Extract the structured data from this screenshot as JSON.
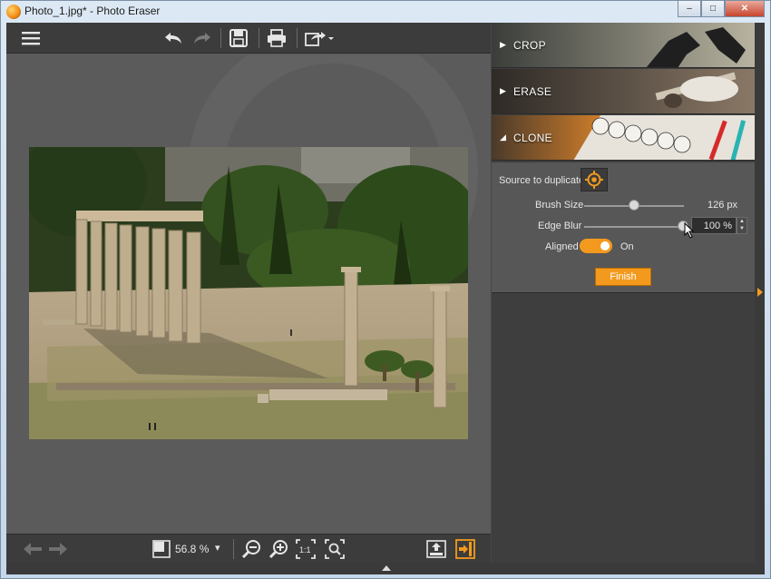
{
  "window": {
    "title": "Photo_1.jpg* - Photo Eraser",
    "minimize": "‒",
    "maximize": "□",
    "close": "✕"
  },
  "toolbar": {
    "icons": [
      "menu-icon",
      "undo-icon",
      "redo-icon",
      "save-icon",
      "print-icon",
      "share-icon"
    ]
  },
  "panel": {
    "sections": [
      {
        "label": "CROP",
        "arrow": "▶",
        "expanded": false
      },
      {
        "label": "ERASE",
        "arrow": "▶",
        "expanded": false
      },
      {
        "label": "CLONE",
        "arrow": "◢",
        "expanded": true
      }
    ],
    "clone": {
      "source_label": "Source to duplicate",
      "brush_size_label": "Brush Size",
      "brush_size_value": "126 px",
      "brush_size_level": 0.5,
      "edge_blur_label": "Edge Blur",
      "edge_blur_value": "100 %",
      "edge_blur_level": 1.0,
      "aligned_label": "Aligned",
      "aligned_state": "On",
      "finish_label": "Finish"
    }
  },
  "bottom": {
    "zoom": "56.8 %",
    "zoom_dropdown": "▾",
    "icons": [
      "back-arrow-icon",
      "forward-arrow-icon",
      "fit-view-icon",
      "zoom-out-icon",
      "zoom-in-icon",
      "actual-size-icon",
      "zoom-fit-icon",
      "export-icon",
      "exit-panel-icon"
    ]
  },
  "colors": {
    "accent": "#f39a1e",
    "panel_bg": "#3e3e3e",
    "editor_bg": "#5a5a5a"
  }
}
